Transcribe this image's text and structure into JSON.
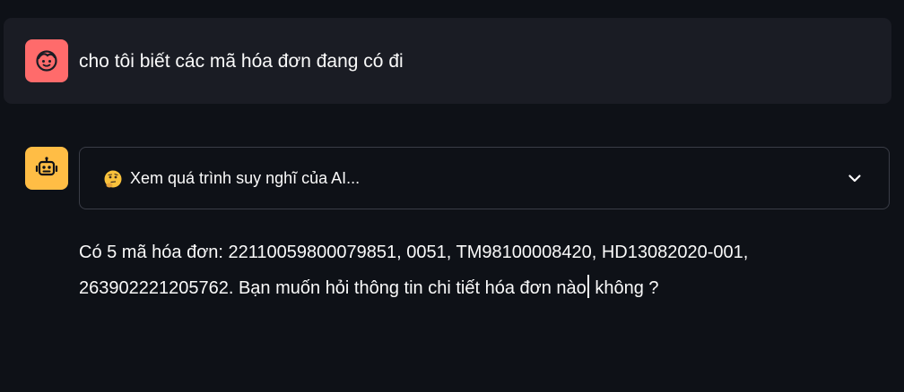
{
  "user_message": {
    "avatar_icon": "user-face-icon",
    "avatar_color": "#ff6b6b",
    "text": "cho tôi biết các mã hóa đơn đang có đi"
  },
  "assistant_message": {
    "avatar_icon": "robot-icon",
    "avatar_color": "#ffbd45",
    "expander": {
      "emoji_icon": "thinking-face-icon",
      "label": "Xem quá trình suy nghĩ của AI...",
      "chevron_icon": "chevron-down-icon"
    },
    "answer_before_cursor": "Có 5 mã hóa đơn: 22110059800079851, 0051, TM98100008420, HD13082020-001, 263902221205762. Bạn muốn hỏi thông tin chi tiết hóa đơn nào",
    "answer_after_cursor": " không ?"
  },
  "colors": {
    "background": "#0e1117",
    "user_bubble": "#1a1c24",
    "text": "#fafafa",
    "border": "#3a3d47"
  }
}
